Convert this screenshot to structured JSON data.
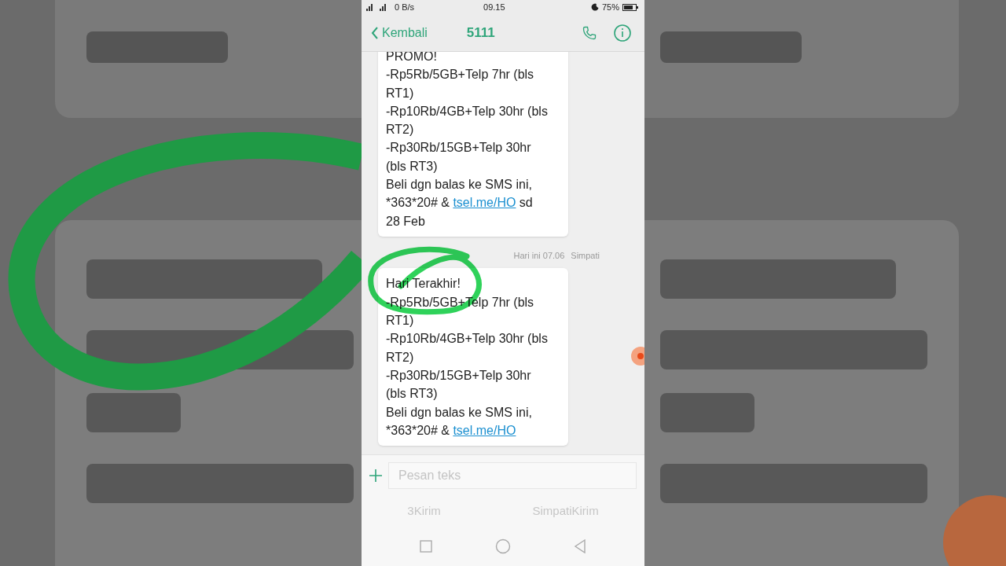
{
  "status_bar": {
    "speed": "0 B/s",
    "time": "09.15",
    "battery": "75%"
  },
  "header": {
    "back": "Kembali",
    "title": "5111"
  },
  "messages": [
    {
      "parts": [
        {
          "text": "PROMO!\n-Rp5Rb/5GB+Telp 7hr (bls\nRT1)\n-Rp10Rb/4GB+Telp 30hr (bls\nRT2)\n-Rp30Rb/15GB+Telp 30hr\n(bls RT3)\nBeli dgn balas ke SMS ini,\n*363*20# & ",
          "link": false
        },
        {
          "text": "tsel.me/HO",
          "link": true
        },
        {
          "text": " sd\n28 Feb",
          "link": false
        }
      ]
    },
    {
      "time": "Hari ini 07.06",
      "sim": "Simpati",
      "parts": [
        {
          "text": "Hari Terakhir!\n-Rp5Rb/5GB+Telp 7hr (bls\nRT1)\n-Rp10Rb/4GB+Telp 30hr (bls\nRT2)\n-Rp30Rb/15GB+Telp 30hr\n(bls RT3)\nBeli dgn balas ke SMS ini,\n*363*20# & ",
          "link": false
        },
        {
          "text": "tsel.me/HO",
          "link": true
        }
      ]
    }
  ],
  "composer": {
    "placeholder": "Pesan teks"
  },
  "send_buttons": [
    "3Kirim",
    "SimpatiKirim"
  ]
}
